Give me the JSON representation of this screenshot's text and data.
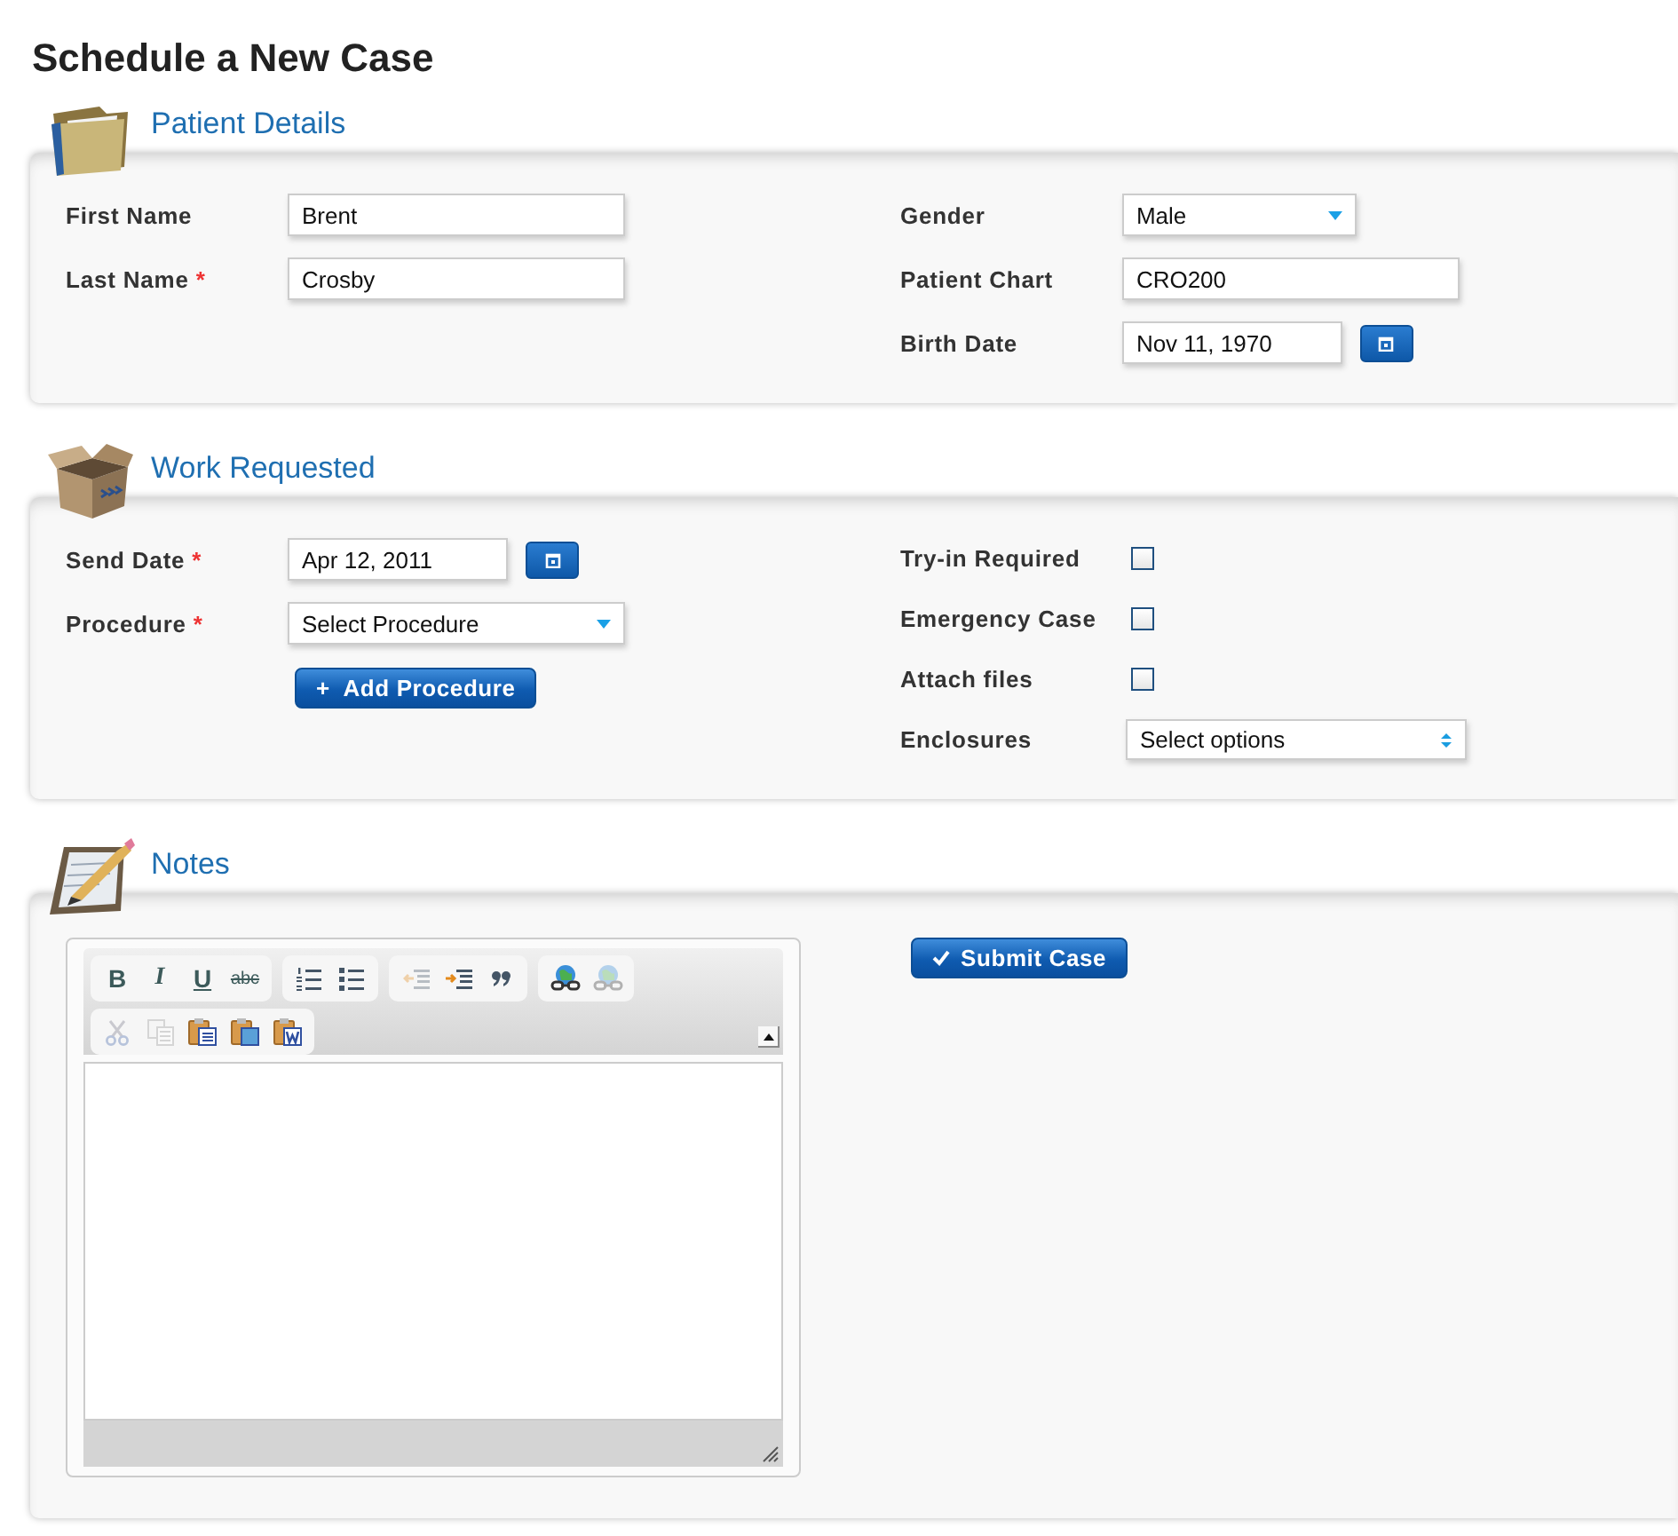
{
  "title": "Schedule a New Case",
  "required_mark": "*",
  "sections": [
    {
      "kind": "folder",
      "title": "Patient Details",
      "left": [
        {
          "kind": "text",
          "label": "First Name",
          "required": false,
          "value": "Brent"
        },
        {
          "kind": "text",
          "label": "Last Name",
          "required": true,
          "value": "Crosby"
        }
      ],
      "right": [
        {
          "kind": "select",
          "label": "Gender",
          "required": false,
          "value": "Male"
        },
        {
          "kind": "text",
          "label": "Patient Chart",
          "required": false,
          "value": "CRO200"
        },
        {
          "kind": "date",
          "label": "Birth Date",
          "required": false,
          "value": "Nov 11, 1970"
        }
      ]
    },
    {
      "kind": "box",
      "title": "Work Requested",
      "left": [
        {
          "kind": "date",
          "label": "Send Date",
          "required": true,
          "value": "Apr 12, 2011"
        },
        {
          "kind": "select",
          "label": "Procedure",
          "required": true,
          "value": "Select Procedure"
        },
        {
          "kind": "button",
          "label": "Add Procedure",
          "symbol": "+"
        }
      ],
      "right": [
        {
          "kind": "checkbox",
          "label": "Try-in Required",
          "required": false,
          "checked": false
        },
        {
          "kind": "checkbox",
          "label": "Emergency Case",
          "required": false,
          "checked": false
        },
        {
          "kind": "checkbox",
          "label": "Attach files",
          "required": false,
          "checked": false
        },
        {
          "kind": "multiselect",
          "label": "Enclosures",
          "required": false,
          "value": "Select options"
        }
      ]
    },
    {
      "kind": "notepad",
      "title": "Notes",
      "toolbar_rows": [
        [
          [
            {
              "kind": "bold",
              "text": "B",
              "disabled": false
            },
            {
              "kind": "italic",
              "text": "I",
              "disabled": false
            },
            {
              "kind": "underline",
              "text": "U",
              "disabled": false
            },
            {
              "kind": "strike",
              "text": "abc",
              "disabled": false
            }
          ],
          [
            {
              "kind": "ordered-list",
              "disabled": false
            },
            {
              "kind": "bullet-list",
              "disabled": false
            }
          ],
          [
            {
              "kind": "outdent",
              "disabled": true
            },
            {
              "kind": "indent",
              "disabled": false
            },
            {
              "kind": "quote",
              "disabled": false
            }
          ],
          [
            {
              "kind": "link",
              "disabled": false
            },
            {
              "kind": "unlink",
              "disabled": true
            }
          ]
        ],
        [
          [
            {
              "kind": "cut",
              "disabled": true
            },
            {
              "kind": "copy",
              "disabled": true
            },
            {
              "kind": "paste",
              "disabled": false
            },
            {
              "kind": "paste-text",
              "disabled": false
            },
            {
              "kind": "paste-word",
              "disabled": false
            }
          ]
        ]
      ],
      "submit": {
        "label": "Submit Case"
      }
    }
  ]
}
